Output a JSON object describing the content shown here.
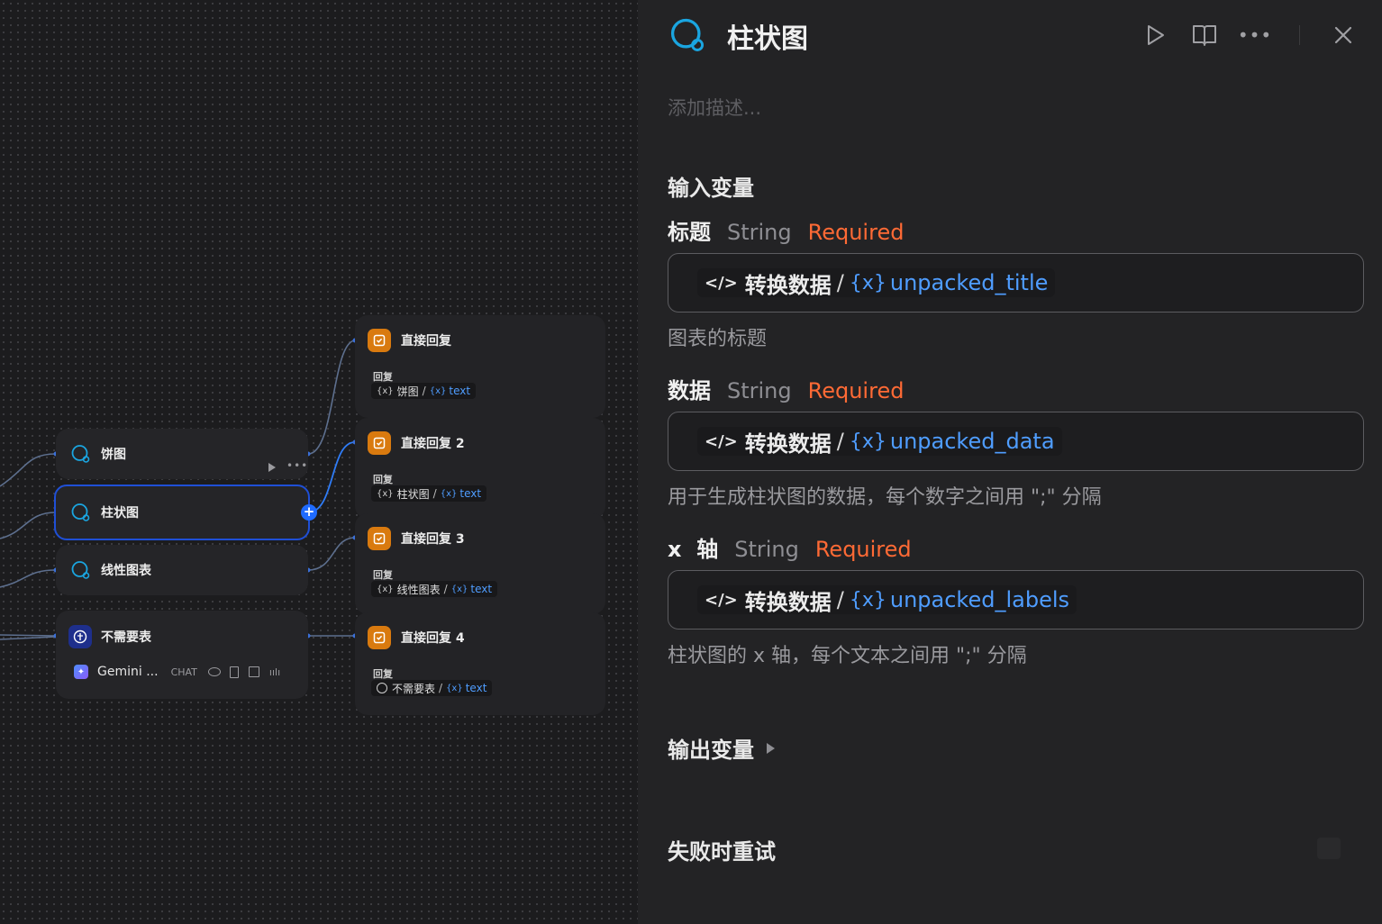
{
  "canvas": {
    "tool_nodes": [
      {
        "label": "饼图",
        "icon": "tool-search-icon"
      },
      {
        "label": "柱状图",
        "icon": "tool-search-icon",
        "selected": true
      },
      {
        "label": "线性图表",
        "icon": "tool-search-icon"
      }
    ],
    "llm_node": {
      "title": "不需要表",
      "icon": "question-classifier-icon",
      "model": "Gemini ...",
      "mode_badge": "CHAT",
      "capability_icons": [
        "eye-icon",
        "document-icon",
        "image-icon",
        "audio-icon"
      ]
    },
    "reply_nodes": [
      {
        "title": "直接回复",
        "label": "回复",
        "source": "饼图",
        "sep": "/",
        "brace": "{x}",
        "var": "text"
      },
      {
        "title": "直接回复 2",
        "label": "回复",
        "source": "柱状图",
        "sep": "/",
        "brace": "{x}",
        "var": "text"
      },
      {
        "title": "直接回复 3",
        "label": "回复",
        "source": "线性图表",
        "sep": "/",
        "brace": "{x}",
        "var": "text"
      },
      {
        "title": "直接回复 4",
        "label": "回复",
        "source": "不需要表",
        "sep": "/",
        "brace": "{x}",
        "var": "text"
      }
    ],
    "colors": {
      "accent": "#1f6bff",
      "reply_badge": "#d97a0f",
      "variable": "#4f9dff"
    }
  },
  "panel": {
    "title": "柱状图",
    "title_icon": "tool-search-icon",
    "header_icons": [
      "run-icon",
      "docs-book-icon",
      "more-icon",
      "close-icon"
    ],
    "description_placeholder": "添加描述...",
    "input_section": "输入变量",
    "variables": [
      {
        "name": "标题",
        "type": "String",
        "required": "Required",
        "node": "转换数据",
        "sep": "/",
        "brace": "{x}",
        "var": "unpacked_title",
        "help": "图表的标题"
      },
      {
        "name": "数据",
        "type": "String",
        "required": "Required",
        "node": "转换数据",
        "sep": "/",
        "brace": "{x}",
        "var": "unpacked_data",
        "help": "用于生成柱状图的数据，每个数字之间用 \";\" 分隔"
      },
      {
        "name": "x  轴",
        "type": "String",
        "required": "Required",
        "node": "转换数据",
        "sep": "/",
        "brace": "{x}",
        "var": "unpacked_labels",
        "help": "柱状图的 x 轴，每个文本之间用 \";\" 分隔"
      }
    ],
    "output_section": "输出变量",
    "retry_section": "失败时重试",
    "colors": {
      "required": "#ff6a35",
      "variable": "#4f9dff",
      "title_icon": "#1aa5e0"
    }
  }
}
